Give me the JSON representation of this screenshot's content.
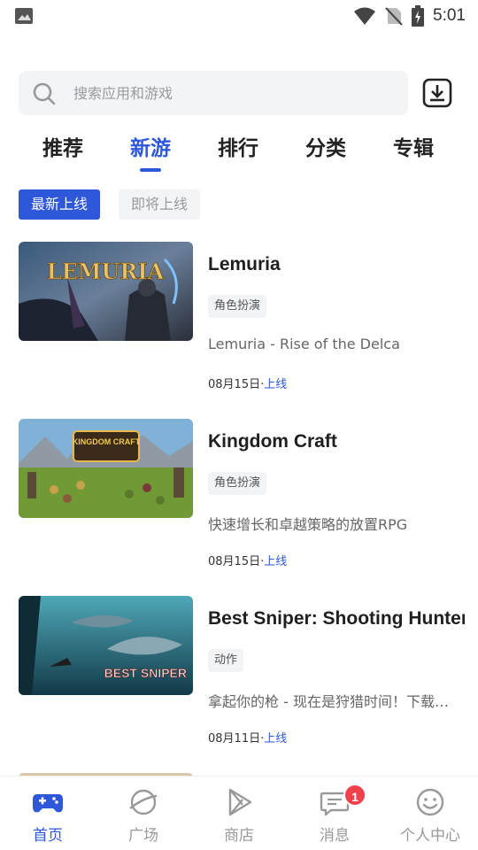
{
  "status_bar": {
    "time": "5:01"
  },
  "search": {
    "placeholder": "搜索应用和游戏"
  },
  "tabs": [
    {
      "label": "推荐",
      "active": false
    },
    {
      "label": "新游",
      "active": true
    },
    {
      "label": "排行",
      "active": false
    },
    {
      "label": "分类",
      "active": false
    },
    {
      "label": "专辑",
      "active": false
    }
  ],
  "filters": [
    {
      "label": "最新上线",
      "active": true
    },
    {
      "label": "即将上线",
      "active": false
    }
  ],
  "games": [
    {
      "title": "Lemuria",
      "tag": "角色扮演",
      "description": "Lemuria - Rise of the Delca",
      "date": "08月15日·",
      "status": "上线",
      "thumb_text": "LEMURIA"
    },
    {
      "title": "Kingdom Craft",
      "tag": "角色扮演",
      "description": "快速增长和卓越策略的放置RPG",
      "date": "08月15日·",
      "status": "上线",
      "thumb_text": "KINGDOM CRAFT"
    },
    {
      "title": "Best Sniper: Shooting Hunter",
      "tag": "动作",
      "description": "拿起你的枪 - 现在是狩猎时间！下载最好的狙击手游戏",
      "date": "08月11日·",
      "status": "上线",
      "thumb_text": "BEST SNIPER"
    }
  ],
  "bottom_nav": [
    {
      "label": "首页",
      "icon": "gamepad-icon",
      "active": true
    },
    {
      "label": "广场",
      "icon": "planet-icon",
      "active": false
    },
    {
      "label": "商店",
      "icon": "play-store-icon",
      "active": false
    },
    {
      "label": "消息",
      "icon": "message-icon",
      "active": false,
      "badge": "1"
    },
    {
      "label": "个人中心",
      "icon": "smiley-icon",
      "active": false
    }
  ],
  "colors": {
    "accent": "#2e58d9",
    "badge": "#f0414a"
  }
}
